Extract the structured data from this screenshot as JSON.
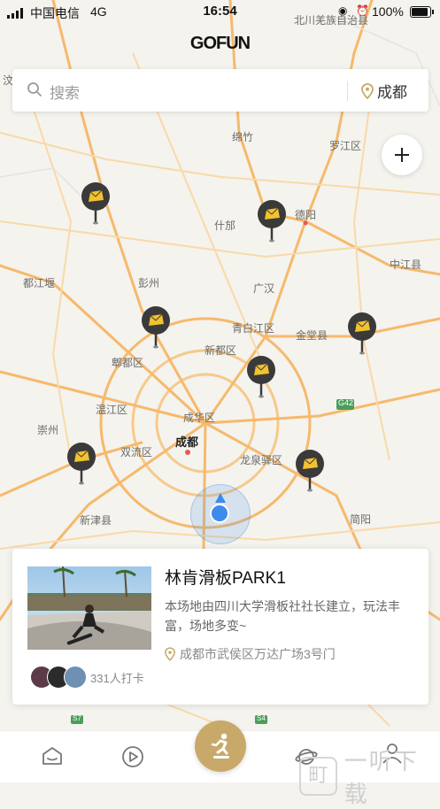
{
  "status_bar": {
    "carrier": "中国电信",
    "network": "4G",
    "time": "16:54",
    "battery": "100%",
    "battery_level": 1.0
  },
  "app": {
    "logo": "GOFUN"
  },
  "search": {
    "placeholder": "搜索",
    "city": "成都"
  },
  "map": {
    "labels": [
      "北川羌族自治县",
      "汶",
      "绵竹",
      "罗江区",
      "什邡",
      "德阳",
      "中江县",
      "都江堰",
      "彭州",
      "广汉",
      "青白江区",
      "金堂县",
      "新都区",
      "郫都区",
      "温江区",
      "成华区",
      "崇州",
      "成都",
      "双流区",
      "龙泉驿区",
      "新津县",
      "简阳",
      "G42",
      "S7",
      "S4"
    ],
    "pin_icon": "tent-icon",
    "pin_count": 8
  },
  "card": {
    "title": "林肯滑板PARK1",
    "description": "本场地由四川大学滑板社社长建立，玩法丰富，场地多变~",
    "address": "成都市武侯区万达广场3号门",
    "checkins": "331人打卡"
  },
  "tabs": [
    {
      "name": "home",
      "icon": "home-icon"
    },
    {
      "name": "play",
      "icon": "play-icon"
    },
    {
      "name": "skate",
      "icon": "skater-icon"
    },
    {
      "name": "planet",
      "icon": "planet-icon"
    },
    {
      "name": "profile",
      "icon": "user-icon"
    }
  ],
  "watermark": {
    "glyph": "町",
    "text": "一听下载"
  },
  "colors": {
    "accent": "#c9a96a",
    "location": "#3d8bea",
    "pin": "#3a3a3a",
    "pin_glyph": "#f2c230"
  }
}
